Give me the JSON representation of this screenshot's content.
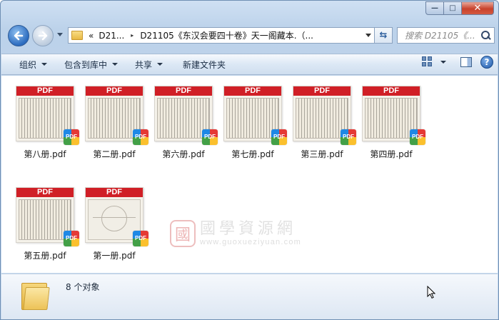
{
  "window": {
    "controls": {
      "minimize": "—",
      "maximize": "□",
      "close": "✕"
    }
  },
  "nav": {
    "back_icon": "back-arrow-icon",
    "forward_icon": "forward-arrow-icon",
    "address": {
      "overflow": "«",
      "crumbs": [
        "D21...",
        "D21105《东汉会要四十卷》天一阁藏本.（..."
      ],
      "separator": "▸"
    },
    "search_placeholder": "搜索 D21105《..."
  },
  "toolbar": {
    "items": [
      "组织",
      "包含到库中",
      "共享",
      "新建文件夹"
    ],
    "help": "?"
  },
  "files": [
    {
      "name": "第八册.pdf",
      "band": "PDF",
      "badge": "PDF"
    },
    {
      "name": "第二册.pdf",
      "band": "PDF",
      "badge": "PDF"
    },
    {
      "name": "第六册.pdf",
      "band": "PDF",
      "badge": "PDF"
    },
    {
      "name": "第七册.pdf",
      "band": "PDF",
      "badge": "PDF"
    },
    {
      "name": "第三册.pdf",
      "band": "PDF",
      "badge": "PDF"
    },
    {
      "name": "第四册.pdf",
      "band": "PDF",
      "badge": "PDF"
    },
    {
      "name": "第五册.pdf",
      "band": "PDF",
      "badge": "PDF"
    },
    {
      "name": "第一册.pdf",
      "band": "PDF",
      "badge": "PDF"
    }
  ],
  "watermark": {
    "seal": "國",
    "chinese": "國學資源網",
    "url": "www.guoxueziyuan.com"
  },
  "status": {
    "count_text": "8 个对象"
  },
  "colors": {
    "pdf_red": "#d01f26",
    "accent_blue": "#2b6bbf"
  }
}
